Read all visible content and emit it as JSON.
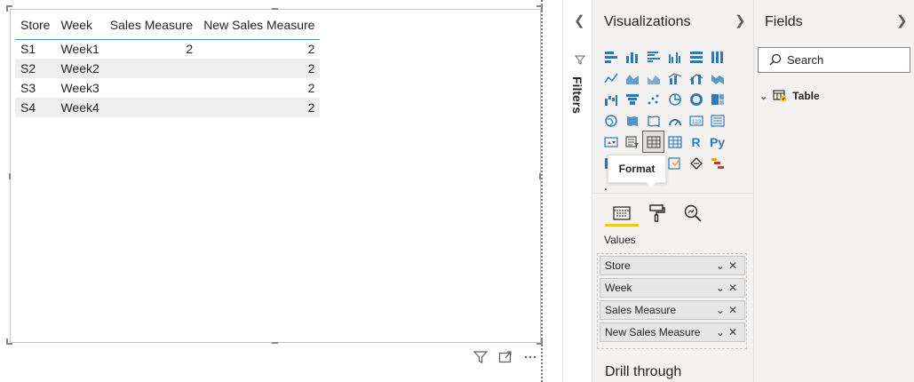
{
  "table": {
    "columns": [
      "Store",
      "Week",
      "Sales Measure",
      "New Sales Measure"
    ],
    "rows": [
      {
        "store": "S1",
        "week": "Week1",
        "sales_measure": "2",
        "new_sales_measure": "2"
      },
      {
        "store": "S2",
        "week": "Week2",
        "sales_measure": "",
        "new_sales_measure": "2"
      },
      {
        "store": "S3",
        "week": "Week3",
        "sales_measure": "",
        "new_sales_measure": "2"
      },
      {
        "store": "S4",
        "week": "Week4",
        "sales_measure": "",
        "new_sales_measure": "2"
      }
    ]
  },
  "filters_pane": {
    "label": "Filters"
  },
  "visualizations": {
    "title": "Visualizations",
    "tooltip": "Format",
    "values_label": "Values",
    "fields": [
      {
        "label": "Store"
      },
      {
        "label": "Week"
      },
      {
        "label": "Sales Measure"
      },
      {
        "label": "New Sales Measure"
      }
    ],
    "drill_through": "Drill through",
    "r_label": "R",
    "py_label": "Py"
  },
  "fields_pane": {
    "title": "Fields",
    "search_placeholder": "Search",
    "table_name": "Table"
  },
  "colors": {
    "accent": "#f2c811",
    "header_border": "#4a90c8",
    "icon_blue": "#2b7bb9"
  }
}
